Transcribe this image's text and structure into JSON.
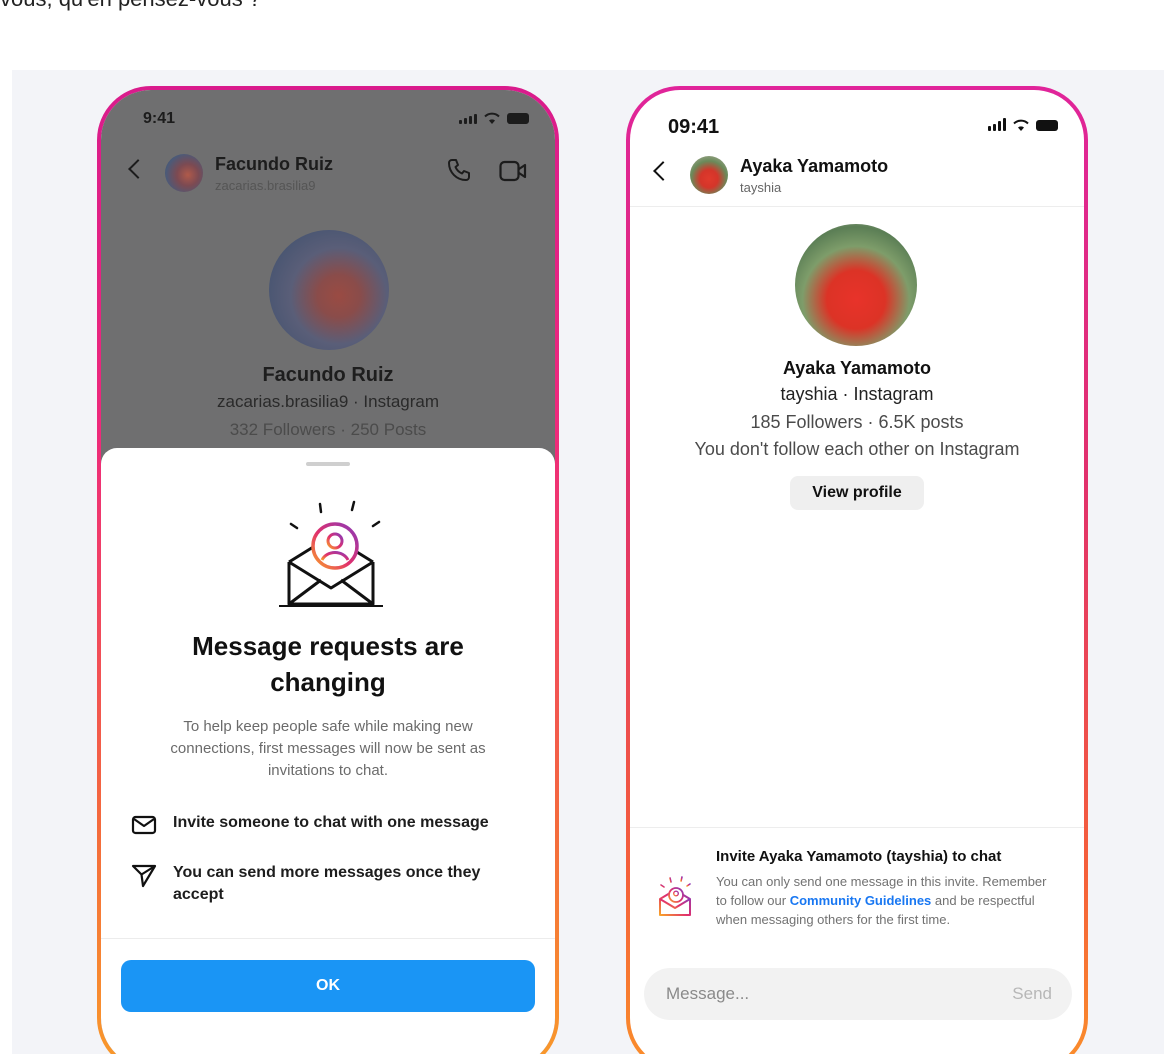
{
  "caption": "vous, qu'en pensez-vous ?",
  "phone1": {
    "status_time": "9:41",
    "contact_name": "Facundo Ruiz",
    "contact_username": "zacarias.brasilia9",
    "profile_name": "Facundo Ruiz",
    "profile_sub": "zacarias.brasilia9 · Instagram",
    "profile_stats": "332 Followers · 250 Posts",
    "sheet": {
      "title": "Message requests are changing",
      "description": "To help keep people safe while making new connections, first messages will now be sent as invitations to chat.",
      "features": [
        {
          "icon": "envelope-icon",
          "text": "Invite someone to chat with one message"
        },
        {
          "icon": "send-icon",
          "text": "You can send more messages once they accept"
        }
      ],
      "ok_label": "OK",
      "accent_color": "#1a95f5"
    }
  },
  "phone2": {
    "status_time": "09:41",
    "contact_name": "Ayaka Yamamoto",
    "contact_username": "tayshia",
    "profile_name": "Ayaka Yamamoto",
    "profile_sub": "tayshia · Instagram",
    "profile_stats": "185 Followers · 6.5K posts",
    "profile_follow": "You don't follow each other on Instagram",
    "view_profile_label": "View profile",
    "invite": {
      "title": "Invite Ayaka Yamamoto (tayshia) to chat",
      "body_before": "You can only send one message in this invite. Remember to follow our ",
      "link_text": "Community Guidelines",
      "body_after": " and be respectful when messaging others for the first time."
    },
    "message_placeholder": "Message...",
    "send_label": "Send"
  }
}
